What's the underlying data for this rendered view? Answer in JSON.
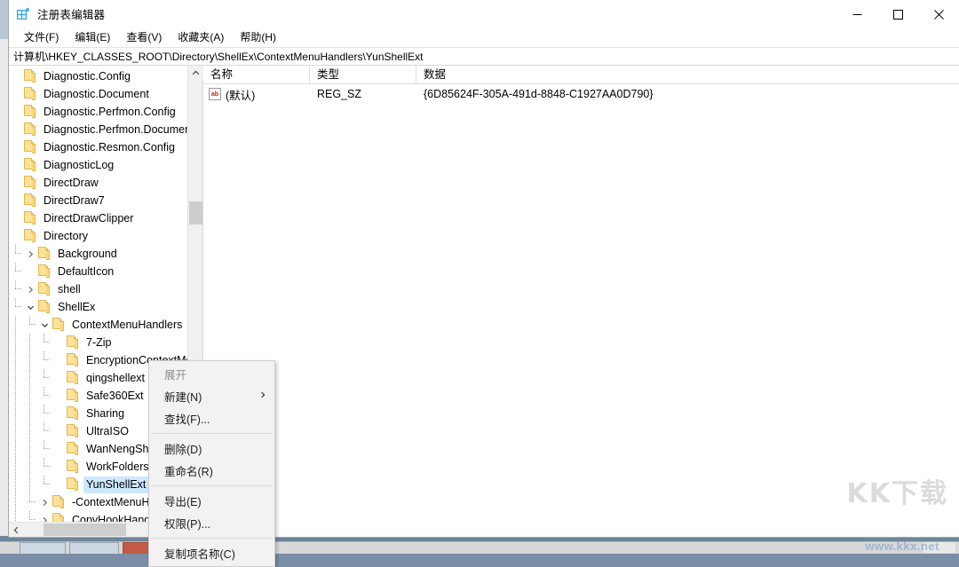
{
  "window": {
    "title": "注册表编辑器",
    "app_icon": "registry-grid-icon",
    "minimize": "—",
    "maximize": "☐",
    "close": "✕"
  },
  "menubar": {
    "items": [
      {
        "label": "文件(F)"
      },
      {
        "label": "编辑(E)"
      },
      {
        "label": "查看(V)"
      },
      {
        "label": "收藏夹(A)"
      },
      {
        "label": "帮助(H)"
      }
    ]
  },
  "address": {
    "path": "计算机\\HKEY_CLASSES_ROOT\\Directory\\ShellEx\\ContextMenuHandlers\\YunShellExt"
  },
  "tree": {
    "nodes": [
      {
        "label": "Diagnostic.Config",
        "depth": 1,
        "arrow": "none",
        "selected": false
      },
      {
        "label": "Diagnostic.Document",
        "depth": 1,
        "arrow": "none",
        "selected": false
      },
      {
        "label": "Diagnostic.Perfmon.Config",
        "depth": 1,
        "arrow": "none",
        "selected": false
      },
      {
        "label": "Diagnostic.Perfmon.Document",
        "depth": 1,
        "arrow": "none",
        "selected": false
      },
      {
        "label": "Diagnostic.Resmon.Config",
        "depth": 1,
        "arrow": "none",
        "selected": false
      },
      {
        "label": "DiagnosticLog",
        "depth": 1,
        "arrow": "none",
        "selected": false
      },
      {
        "label": "DirectDraw",
        "depth": 1,
        "arrow": "none",
        "selected": false
      },
      {
        "label": "DirectDraw7",
        "depth": 1,
        "arrow": "none",
        "selected": false
      },
      {
        "label": "DirectDrawClipper",
        "depth": 1,
        "arrow": "none",
        "selected": false
      },
      {
        "label": "Directory",
        "depth": 1,
        "arrow": "none",
        "selected": false
      },
      {
        "label": "Background",
        "depth": 2,
        "arrow": "collapsed",
        "selected": false
      },
      {
        "label": "DefaultIcon",
        "depth": 2,
        "arrow": "none",
        "selected": false
      },
      {
        "label": "shell",
        "depth": 2,
        "arrow": "collapsed",
        "selected": false
      },
      {
        "label": "ShellEx",
        "depth": 2,
        "arrow": "expanded",
        "selected": false
      },
      {
        "label": "ContextMenuHandlers",
        "depth": 3,
        "arrow": "expanded",
        "selected": false
      },
      {
        "label": "7-Zip",
        "depth": 4,
        "arrow": "none",
        "selected": false
      },
      {
        "label": "EncryptionContextMenu",
        "depth": 4,
        "arrow": "none",
        "selected": false
      },
      {
        "label": "qingshellext",
        "depth": 4,
        "arrow": "none",
        "selected": false
      },
      {
        "label": "Safe360Ext",
        "depth": 4,
        "arrow": "none",
        "selected": false
      },
      {
        "label": "Sharing",
        "depth": 4,
        "arrow": "none",
        "selected": false
      },
      {
        "label": "UltraISO",
        "depth": 4,
        "arrow": "none",
        "selected": false
      },
      {
        "label": "WanNengShellExt",
        "depth": 4,
        "arrow": "none",
        "selected": false
      },
      {
        "label": "WorkFolders",
        "depth": 4,
        "arrow": "none",
        "selected": false
      },
      {
        "label": "YunShellExt",
        "depth": 4,
        "arrow": "none",
        "selected": true
      },
      {
        "label": "-ContextMenuHandlers",
        "depth": 3,
        "arrow": "collapsed",
        "selected": false
      },
      {
        "label": "CopyHookHandlers",
        "depth": 3,
        "arrow": "collapsed",
        "selected": false
      }
    ],
    "scroll_up_icon": "chevron-up-icon",
    "scroll_down_icon": "chevron-down-icon",
    "scroll_left_icon": "chevron-left-icon",
    "scroll_right_icon": "chevron-right-icon"
  },
  "list": {
    "columns": [
      {
        "label": "名称"
      },
      {
        "label": "类型"
      },
      {
        "label": "数据"
      }
    ],
    "rows": [
      {
        "icon": "string-value-icon",
        "icon_text": "ab",
        "name": "(默认)",
        "type": "REG_SZ",
        "data": "{6D85624F-305A-491d-8848-C1927AA0D790}"
      }
    ]
  },
  "context_menu": {
    "items": [
      {
        "label": "展开",
        "disabled": true,
        "submenu": false,
        "separator_after": false
      },
      {
        "label": "新建(N)",
        "disabled": false,
        "submenu": true,
        "separator_after": false
      },
      {
        "label": "查找(F)...",
        "disabled": false,
        "submenu": false,
        "separator_after": true
      },
      {
        "label": "删除(D)",
        "disabled": false,
        "submenu": false,
        "separator_after": false
      },
      {
        "label": "重命名(R)",
        "disabled": false,
        "submenu": false,
        "separator_after": true
      },
      {
        "label": "导出(E)",
        "disabled": false,
        "submenu": false,
        "separator_after": false
      },
      {
        "label": "权限(P)...",
        "disabled": false,
        "submenu": false,
        "separator_after": true
      },
      {
        "label": "复制项名称(C)",
        "disabled": false,
        "submenu": false,
        "separator_after": false
      }
    ],
    "submenu_arrow": "chevron-right-icon"
  },
  "watermark": {
    "primary": "KK下载",
    "secondary": "www.kkx.net"
  },
  "colors": {
    "selection": "#cde8ff",
    "folder": "#fde29a",
    "menu_bg": "#f2f2f2",
    "scrollbar_thumb": "#cdcdcd"
  }
}
